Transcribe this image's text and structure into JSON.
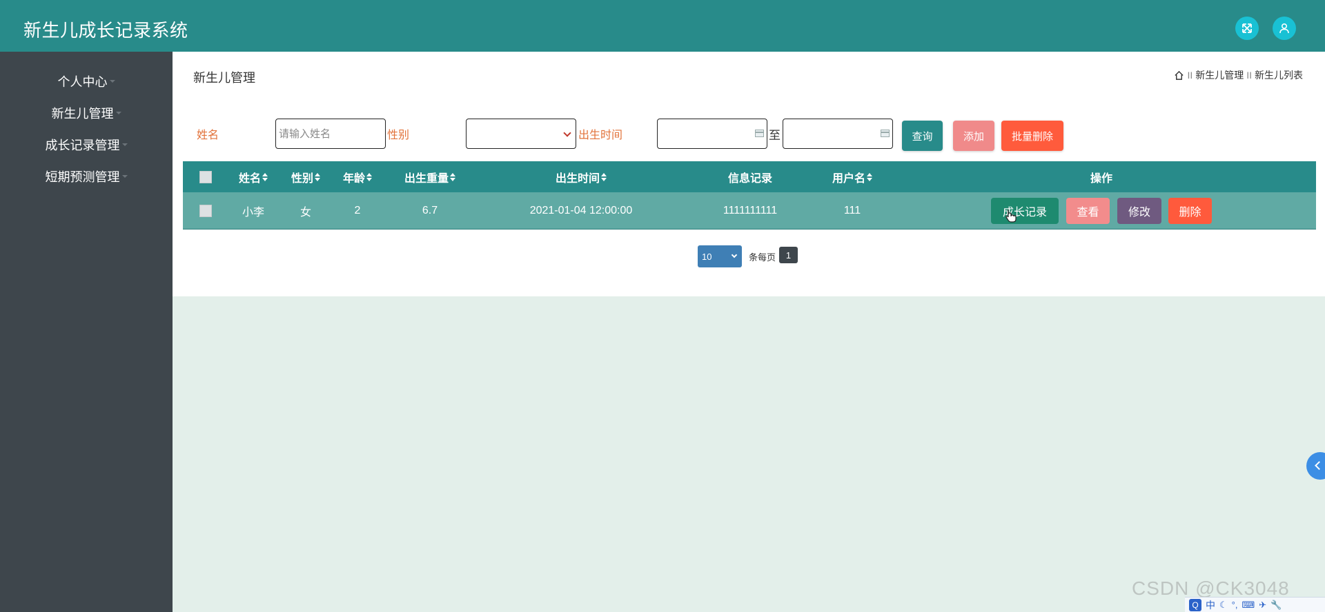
{
  "header": {
    "app_title": "新生儿成长记录系统",
    "icons": [
      "fullscreen-icon",
      "user-icon"
    ]
  },
  "sidebar": {
    "items": [
      {
        "label": "个人中心"
      },
      {
        "label": "新生儿管理"
      },
      {
        "label": "成长记录管理"
      },
      {
        "label": "短期预测管理"
      }
    ]
  },
  "page": {
    "title": "新生儿管理",
    "breadcrumb": {
      "separator": "II",
      "items": [
        "新生儿管理",
        "新生儿列表"
      ]
    }
  },
  "filters": {
    "name_label": "姓名",
    "name_placeholder": "请输入姓名",
    "name_value": "",
    "gender_label": "性别",
    "gender_value": "",
    "birth_label": "出生时间",
    "birth_from": "",
    "birth_to": "",
    "range_sep": "至",
    "search_btn": "查询",
    "add_btn": "添加",
    "batch_delete_btn": "批量删除"
  },
  "table": {
    "columns": [
      "姓名",
      "性别",
      "年龄",
      "出生重量",
      "出生时间",
      "信息记录",
      "用户名",
      "操作"
    ],
    "rows": [
      {
        "name": "小李",
        "gender": "女",
        "age": "2",
        "weight": "6.7",
        "birth_time": "2021-01-04 12:00:00",
        "info": "1111111111",
        "username": "111",
        "actions": [
          "成长记录",
          "查看",
          "修改",
          "删除"
        ]
      }
    ]
  },
  "pagination": {
    "page_size": "10",
    "per_page_label": "条每页",
    "current_page": "1"
  },
  "watermark": "CSDN @CK3048",
  "tray": {
    "ime_logo": "Q",
    "ime_mode": "中",
    "glyphs": [
      "☾",
      "°,",
      "⌨",
      "✈",
      "🔧"
    ]
  },
  "colors": {
    "header": "#288b8a",
    "sidebar": "#3e464c",
    "filter_label": "#e2723a",
    "search_btn": "#288b8a",
    "add_btn": "#f08a8a",
    "batch_delete_btn": "#ff5b3c",
    "row_bg": "#60aaa4",
    "growth_btn": "#1e8a6f",
    "view_btn": "#f28c8c",
    "edit_btn": "#6f5a80",
    "delete_btn": "#ff5a3c",
    "pager": "#3f7fb5"
  }
}
